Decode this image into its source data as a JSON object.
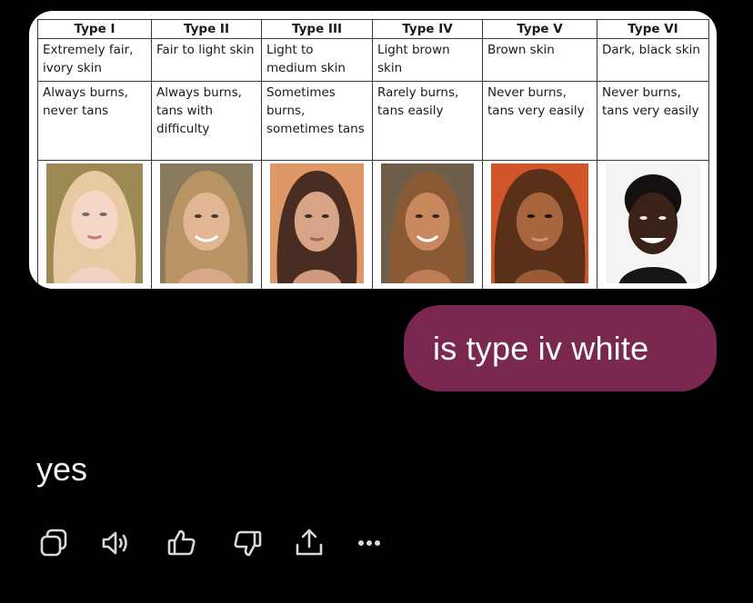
{
  "conversation": {
    "attachment": {
      "headers": [
        "Type I",
        "Type II",
        "Type III",
        "Type IV",
        "Type V",
        "Type VI"
      ],
      "skin_tone": [
        "Extremely fair, ivory skin",
        "Fair to light skin",
        "Light to medium skin",
        "Light brown skin",
        "Brown skin",
        "Dark, black skin"
      ],
      "sun_response": [
        "Always burns, never tans",
        "Always burns, tans with difficulty",
        "Sometimes burns, sometimes tans",
        "Rarely burns, tans easily",
        "Never burns, tans very easily",
        "Never burns, tans very easily"
      ]
    },
    "user_message": "is type iv white",
    "assistant_reply": "yes"
  },
  "actions": {
    "icons": [
      "copy-icon",
      "read-aloud-icon",
      "thumbs-up-icon",
      "thumbs-down-icon",
      "share-icon",
      "more-icon"
    ]
  },
  "colors": {
    "background": "#000000",
    "user_bubble": "#7b2850",
    "text": "#f2f2f2",
    "icon": "#d8d8d8"
  }
}
